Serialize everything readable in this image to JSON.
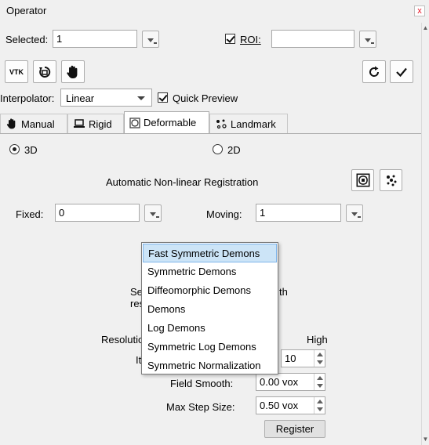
{
  "window": {
    "title": "Operator",
    "close": "x"
  },
  "top": {
    "selected_label": "Selected:",
    "selected_value": "1",
    "roi_label": "ROI:",
    "roi_value": "",
    "roi_checked": true
  },
  "toolbar": {
    "vtk_label": "VTK",
    "buttons": [
      "vtk-icon",
      "rotate-reset-icon",
      "hand-icon",
      "refresh-icon",
      "check-icon"
    ]
  },
  "interp": {
    "label": "Interpolator:",
    "value": "Linear",
    "quick_preview_label": "Quick Preview",
    "quick_preview_checked": true
  },
  "tabs": [
    {
      "label": "Manual",
      "icon": "hand-icon"
    },
    {
      "label": "Rigid",
      "icon": "laptop-icon"
    },
    {
      "label": "Deformable",
      "icon": "deform-icon",
      "active": true
    },
    {
      "label": "Landmark",
      "icon": "landmark-icon"
    }
  ],
  "deformable": {
    "mode_3d": "3D",
    "mode_2d": "2D",
    "heading": "Automatic Non-linear Registration",
    "fixed_label": "Fixed:",
    "fixed_value": "0",
    "moving_label": "Moving:",
    "moving_value": "1",
    "hidden_text_1": "Se",
    "hidden_text_2": "res",
    "hidden_text_3": "th",
    "resolution_label": "Resolutio",
    "resolution_high": "High",
    "iterations_label": "It",
    "iterations_value": "10",
    "field_smooth_label": "Field Smooth:",
    "field_smooth_value": "0.00 vox",
    "max_step_label": "Max Step Size:",
    "max_step_value": "0.50 vox",
    "register_label": "Register"
  },
  "dropdown": {
    "items": [
      "Fast Symmetric Demons",
      "Symmetric Demons",
      "Diffeomorphic Demons",
      "Demons",
      "Log Demons",
      "Symmetric Log Demons",
      "Symmetric Normalization"
    ],
    "selected": "Fast Symmetric Demons"
  }
}
